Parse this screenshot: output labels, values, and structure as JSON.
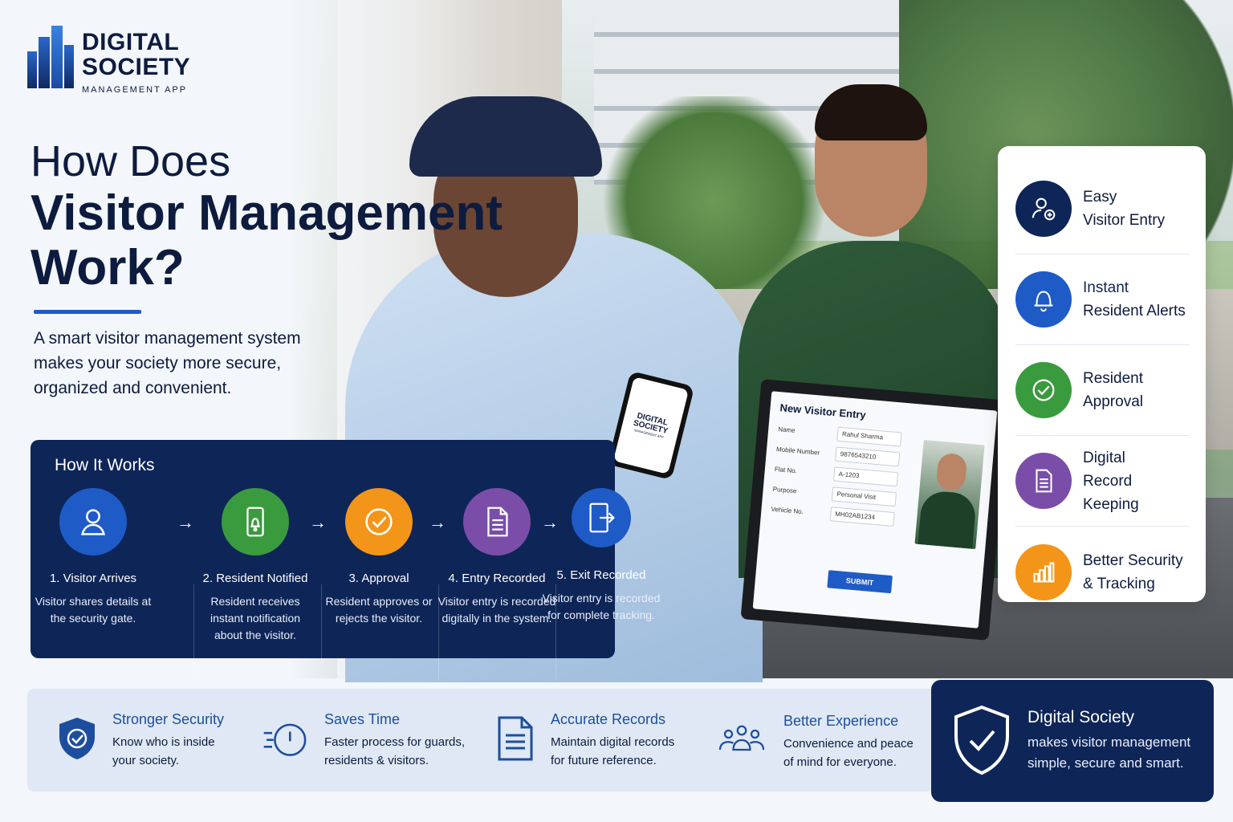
{
  "logo": {
    "line1": "DIGITAL",
    "line2": "SOCIETY",
    "line3": "MANAGEMENT APP"
  },
  "title": {
    "line1": "How Does",
    "line2": "Visitor Management",
    "line3": "Work?"
  },
  "intro": "A smart visitor management system makes your society more secure, organized and convenient.",
  "phone": {
    "brand1": "DIGITAL",
    "brand2": "SOCIETY",
    "brand3": "MANAGEMENT APP"
  },
  "form": {
    "title": "New Visitor Entry",
    "fields": [
      {
        "label": "Name",
        "value": "Rahul Sharma"
      },
      {
        "label": "Mobile Number",
        "value": "9876543210"
      },
      {
        "label": "Flat No.",
        "value": "A-1203"
      },
      {
        "label": "Purpose",
        "value": "Personal Visit"
      },
      {
        "label": "Vehicle No.",
        "value": "MH02AB1234"
      }
    ],
    "submit": "SUBMIT"
  },
  "how": {
    "heading": "How It Works",
    "steps": [
      {
        "title": "1. Visitor Arrives",
        "desc": "Visitor shares details at the security gate.",
        "color": "#1e5bc6",
        "icon": "user-icon"
      },
      {
        "title": "2. Resident Notified",
        "desc": "Resident receives instant notification about the visitor.",
        "color": "#3a9a3e",
        "icon": "phone-bell-icon"
      },
      {
        "title": "3. Approval",
        "desc": "Resident approves or rejects the visitor.",
        "color": "#f39519",
        "icon": "check-icon"
      },
      {
        "title": "4. Entry Recorded",
        "desc": "Visitor entry is recorded digitally in the system.",
        "color": "#7a4ea8",
        "icon": "document-icon"
      },
      {
        "title": "5. Exit Recorded",
        "desc": "Visitor entry is recorded for complete tracking.",
        "color": "#1e5bc6",
        "icon": "exit-door-icon"
      }
    ]
  },
  "features": [
    {
      "line1": "Easy",
      "line2": "Visitor Entry",
      "color": "#0e2557",
      "icon": "add-user-icon"
    },
    {
      "line1": "Instant",
      "line2": "Resident Alerts",
      "color": "#1e5bc6",
      "icon": "bell-icon"
    },
    {
      "line1": "Resident",
      "line2": "Approval",
      "color": "#3a9a3e",
      "icon": "check-circle-icon"
    },
    {
      "line1": "Digital",
      "line2": "Record Keeping",
      "color": "#7a4ea8",
      "icon": "document-icon"
    },
    {
      "line1": "Better Security",
      "line2": "& Tracking",
      "color": "#f39519",
      "icon": "bar-chart-icon"
    }
  ],
  "benefits": [
    {
      "title": "Stronger Security",
      "desc1": "Know who is inside",
      "desc2": "your society.",
      "icon": "shield-check-icon"
    },
    {
      "title": "Saves Time",
      "desc1": "Faster process for guards,",
      "desc2": "residents & visitors.",
      "icon": "timer-icon"
    },
    {
      "title": "Accurate Records",
      "desc1": "Maintain digital records",
      "desc2": "for future reference.",
      "icon": "document-icon"
    },
    {
      "title": "Better Experience",
      "desc1": "Convenience and peace",
      "desc2": "of mind for everyone.",
      "icon": "people-icon"
    }
  ],
  "cta": {
    "title": "Digital Society",
    "line1": "makes visitor management",
    "line2": "simple, secure and smart."
  },
  "colors": {
    "navy": "#0e2557",
    "blue": "#1e5bc6",
    "green": "#3a9a3e",
    "orange": "#f39519",
    "purple": "#7a4ea8"
  }
}
